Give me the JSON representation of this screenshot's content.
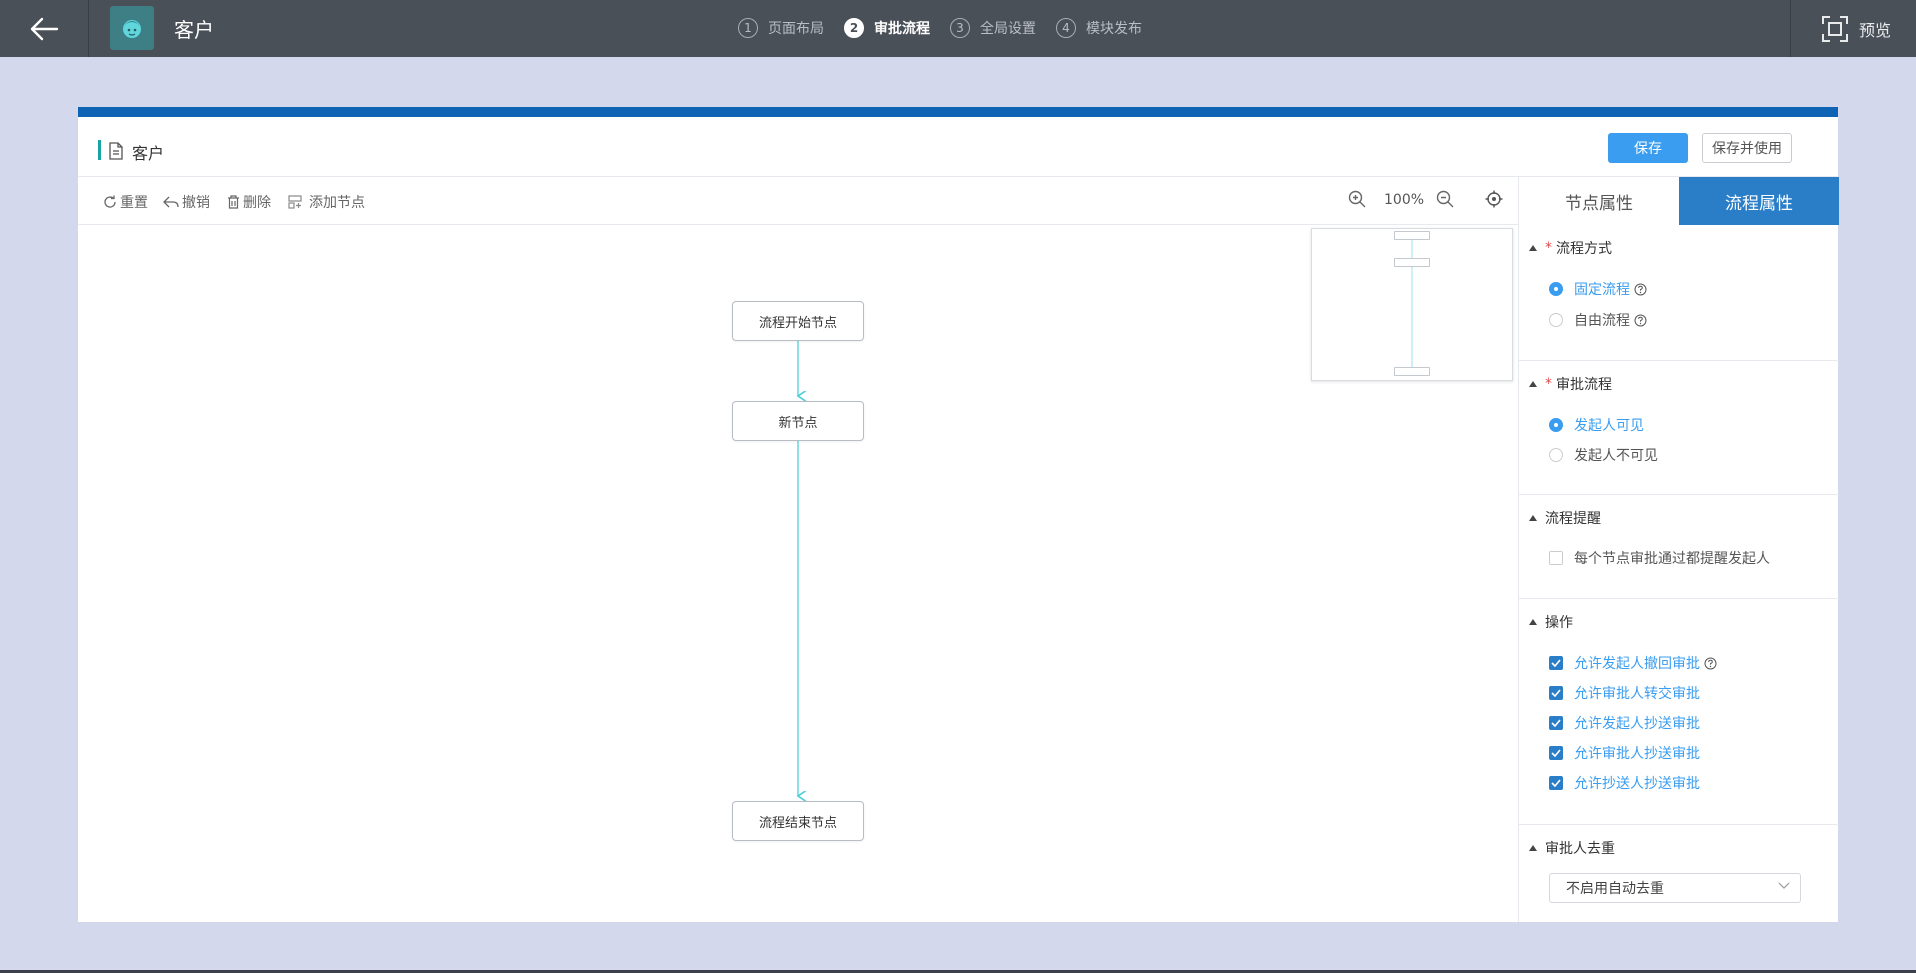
{
  "app": {
    "title": "客户",
    "preview_label": "预览"
  },
  "steps": [
    {
      "num": "1",
      "label": "页面布局",
      "active": false
    },
    {
      "num": "2",
      "label": "审批流程",
      "active": true
    },
    {
      "num": "3",
      "label": "全局设置",
      "active": false
    },
    {
      "num": "4",
      "label": "模块发布",
      "active": false
    }
  ],
  "panel": {
    "page_name": "客户",
    "save_label": "保存",
    "save_use_label": "保存并使用"
  },
  "toolbar": {
    "reset_label": "重置",
    "undo_label": "撤销",
    "delete_label": "删除",
    "add_node_label": "添加节点",
    "zoom_value": "100%"
  },
  "flow": {
    "nodes": [
      {
        "id": "start",
        "label": "流程开始节点"
      },
      {
        "id": "new",
        "label": "新节点"
      },
      {
        "id": "end",
        "label": "流程结束节点"
      }
    ]
  },
  "props": {
    "tabs": [
      {
        "label": "节点属性",
        "active": false
      },
      {
        "label": "流程属性",
        "active": true
      }
    ],
    "flow_mode": {
      "title": "流程方式",
      "options": [
        {
          "label": "固定流程",
          "selected": true
        },
        {
          "label": "自由流程",
          "selected": false
        }
      ]
    },
    "approval_flow": {
      "title": "审批流程",
      "options": [
        {
          "label": "发起人可见",
          "selected": true
        },
        {
          "label": "发起人不可见",
          "selected": false
        }
      ]
    },
    "reminder": {
      "title": "流程提醒",
      "option": {
        "label": "每个节点审批通过都提醒发起人",
        "checked": false
      }
    },
    "operations": {
      "title": "操作",
      "options": [
        {
          "label": "允许发起人撤回审批",
          "checked": true
        },
        {
          "label": "允许审批人转交审批",
          "checked": true
        },
        {
          "label": "允许发起人抄送审批",
          "checked": true
        },
        {
          "label": "允许审批人抄送审批",
          "checked": true
        },
        {
          "label": "允许抄送人抄送审批",
          "checked": true
        }
      ]
    },
    "dedupe": {
      "title": "审批人去重",
      "selected": "不启用自动去重"
    }
  },
  "colors": {
    "topbar": "#4a5058",
    "accent_blue": "#3a9df0",
    "tab_active": "#2a7ec7",
    "panel_border": "#0f63b5",
    "flow_line": "#4fd1d9",
    "background": "#d4d8ec"
  }
}
